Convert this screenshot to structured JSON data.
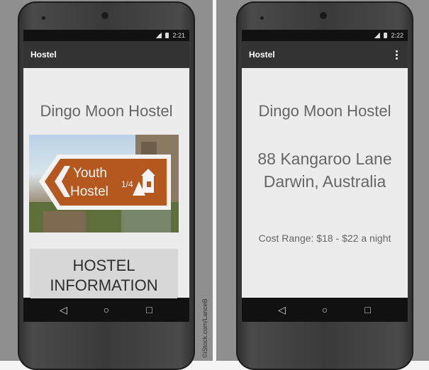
{
  "credit": "©iStock.com/LanceB",
  "status_bar": {
    "left_time": "2:21",
    "right_time": "2:22"
  },
  "app": {
    "title": "Hostel"
  },
  "screen_main": {
    "hostel_name": "Dingo Moon Hostel",
    "photo": {
      "sign_line1": "Youth",
      "sign_line2": "Hostel",
      "sign_fraction": "1/4"
    },
    "info_button_label": "HOSTEL\nINFORMATION"
  },
  "screen_info": {
    "hostel_name": "Dingo Moon Hostel",
    "address_line1": "88 Kangaroo Lane",
    "address_line2": "Darwin, Australia",
    "cost_range": "Cost Range: $18 - $22 a night"
  },
  "nav": {
    "back": "◁",
    "home": "○",
    "recents": "□"
  },
  "icons": {
    "signal": "signal-icon",
    "battery": "battery-icon",
    "overflow": "overflow-menu-icon",
    "back": "back-icon",
    "home": "home-icon",
    "recents": "recents-icon"
  }
}
